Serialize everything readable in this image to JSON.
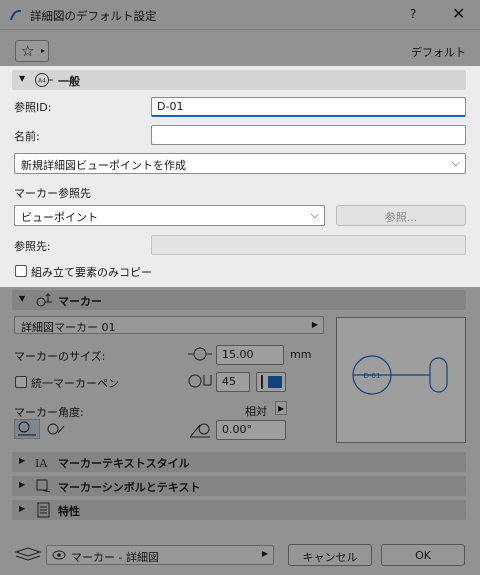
{
  "window": {
    "title": "詳細図のデフォルト設定",
    "help": "?",
    "close": "✕"
  },
  "favorites": {
    "star": "☆",
    "arrow": "▸",
    "default_label": "デフォルト"
  },
  "general": {
    "section_title": "一般",
    "ref_id_label": "参照ID:",
    "ref_id_value": "D-01",
    "name_label": "名前:",
    "name_value": "",
    "viewpoint_option": "新規詳細図ビューポイントを作成",
    "marker_ref_label": "マーカー参照先",
    "marker_ref_value": "ビューポイント",
    "browse_label": "参照...",
    "ref_target_label": "参照先:",
    "ref_target_value": "",
    "copy_elements_label": "組み立て要素のみコピー"
  },
  "marker": {
    "section_title": "マーカー",
    "marker_type": "詳細図マーカー 01",
    "size_label": "マーカーのサイズ:",
    "size_value": "15.00",
    "size_unit": "mm",
    "uniform_pen_label": "統一マーカーペン",
    "pen_value": "45",
    "pen_color": "#1e6fc8",
    "angle_label": "マーカー角度:",
    "angle_mode": "相対",
    "angle_value": "0.00°",
    "preview_text": "D-01"
  },
  "collapsed_sections": [
    {
      "label": "マーカーテキストスタイル"
    },
    {
      "label": "マーカーシンボルとテキスト"
    },
    {
      "label": "特性"
    }
  ],
  "footer": {
    "layer_value": "マーカー - 詳細図",
    "cancel_label": "キャンセル",
    "ok_label": "OK"
  },
  "colors": {
    "accent": "#1565c0",
    "highlight_bg": "#ececec"
  }
}
